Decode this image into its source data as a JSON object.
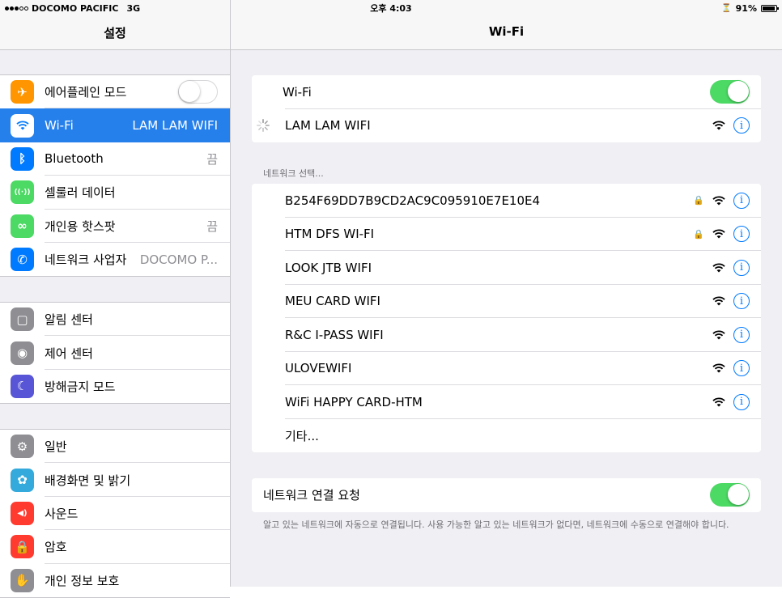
{
  "status_bar": {
    "carrier": "DOCOMO PACIFIC",
    "network": "3G",
    "time": "오후 4:03",
    "battery": "91%",
    "battery_level": 0.91
  },
  "sidebar": {
    "title": "설정",
    "groups": [
      [
        {
          "label": "에어플레인 모드",
          "icon": "airplane-icon",
          "color": "#ff9500",
          "toggle": "off"
        },
        {
          "label": "Wi-Fi",
          "icon": "wifi-icon",
          "color": "#007aff",
          "value": "LAM LAM WIFI",
          "selected": true
        },
        {
          "label": "Bluetooth",
          "icon": "bluetooth-icon",
          "color": "#007aff",
          "value": "끔"
        },
        {
          "label": "셀룰러 데이터",
          "icon": "cellular-antenna-icon",
          "color": "#4cd964"
        },
        {
          "label": "개인용 핫스팟",
          "icon": "hotspot-link-icon",
          "color": "#4cd964",
          "value": "끔"
        },
        {
          "label": "네트워크 사업자",
          "icon": "phone-icon",
          "color": "#007aff",
          "value": "DOCOMO P..."
        }
      ],
      [
        {
          "label": "알림 센터",
          "icon": "notification-center-icon",
          "color": "#8e8e93"
        },
        {
          "label": "제어 센터",
          "icon": "control-center-icon",
          "color": "#8e8e93"
        },
        {
          "label": "방해금지 모드",
          "icon": "moon-icon",
          "color": "#5856d6"
        }
      ],
      [
        {
          "label": "일반",
          "icon": "gear-icon",
          "color": "#8e8e93"
        },
        {
          "label": "배경화면 및 밝기",
          "icon": "wallpaper-flower-icon",
          "color": "#34aadc"
        },
        {
          "label": "사운드",
          "icon": "speaker-icon",
          "color": "#ff3b30"
        },
        {
          "label": "암호",
          "icon": "lock-icon",
          "color": "#ff3b30"
        },
        {
          "label": "개인 정보 보호",
          "icon": "hand-icon",
          "color": "#8e8e93"
        }
      ]
    ]
  },
  "main": {
    "title": "Wi-Fi",
    "wifi_label": "Wi-Fi",
    "wifi_toggle": "on",
    "connected_network": "LAM LAM WIFI",
    "choose_network_header": "네트워크 선택...",
    "networks": [
      {
        "name": "B254F69DD7B9CD2AC9C095910E7E10E4",
        "locked": true
      },
      {
        "name": "HTM DFS WI-FI",
        "locked": true
      },
      {
        "name": "LOOK JTB WIFI",
        "locked": false
      },
      {
        "name": "MEU CARD WIFI",
        "locked": false
      },
      {
        "name": "R&C I-PASS WIFI",
        "locked": false
      },
      {
        "name": "ULOVEWIFI",
        "locked": false
      },
      {
        "name": "WiFi HAPPY CARD-HTM",
        "locked": false
      }
    ],
    "other_label": "기타...",
    "ask_to_join_label": "네트워크 연결 요청",
    "ask_to_join_toggle": "on",
    "ask_to_join_footnote": "알고 있는 네트워크에 자동으로 연결됩니다. 사용 가능한 알고 있는 네트워크가 없다면, 네트워크에 수동으로 연결해야 합니다.",
    "info_glyph": "i",
    "lock_glyph": "🔒"
  },
  "colors": {
    "accent": "#007aff",
    "selected_row": "#2680eb",
    "toggle_on": "#4cd964",
    "background": "#efeff4"
  }
}
